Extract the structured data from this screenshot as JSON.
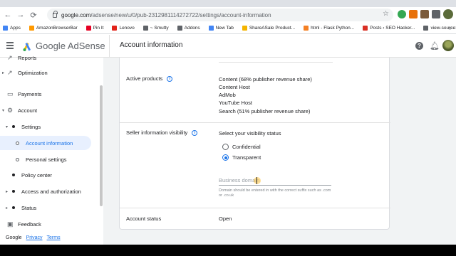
{
  "browser": {
    "url_host": "google.com",
    "url_path": "/adsense/new/u/0/pub-2312981114272722/settings/account-information",
    "bookmarks": [
      "Apps",
      "AmazonBrowserBar",
      "Pin It",
      "Lenovo",
      "~ Smutty",
      "Addons",
      "New Tab",
      "ShareASale Product...",
      "html - Flask Python...",
      "Posts ‹ SEO Hacker...",
      "view-source:https://..."
    ],
    "bookmark_colors": [
      "#4285f4",
      "#ff9900",
      "#e60023",
      "#e2231a",
      "#5f6368",
      "#5f6368",
      "#4285f4",
      "#f4b400",
      "#f48024",
      "#d93025",
      "#5f6368"
    ]
  },
  "app": {
    "brand": "Google AdSense",
    "page_title": "Account information"
  },
  "sidebar": {
    "items": [
      {
        "label": "Reports",
        "icon": "trending-icon"
      },
      {
        "label": "Optimization",
        "icon": "trending-up-icon"
      },
      {
        "label": "Payments",
        "icon": "payments-icon"
      },
      {
        "label": "Account",
        "icon": "gear-icon"
      },
      {
        "label": "Settings"
      },
      {
        "label": "Account information"
      },
      {
        "label": "Personal settings"
      },
      {
        "label": "Policy center"
      },
      {
        "label": "Access and authorization"
      },
      {
        "label": "Status"
      },
      {
        "label": "Feedback",
        "icon": "feedback-icon"
      }
    ],
    "footer": {
      "brand": "Google",
      "privacy": "Privacy",
      "terms": "Terms"
    }
  },
  "main": {
    "active_products": {
      "label": "Active products",
      "values": [
        "Content (68% publisher revenue share)",
        "Content Host",
        "AdMob",
        "YouTube Host",
        "Search (51% publisher revenue share)"
      ]
    },
    "seller_visibility": {
      "label": "Seller information visibility",
      "prompt": "Select your visibility status",
      "options": [
        {
          "label": "Confidential",
          "selected": false
        },
        {
          "label": "Transparent",
          "selected": true
        }
      ],
      "domain_placeholder": "Business domain",
      "domain_hint": "Domain should be entered in with the correct suffix such as .com or .co.uk"
    },
    "account_status": {
      "label": "Account status",
      "value": "Open"
    }
  }
}
